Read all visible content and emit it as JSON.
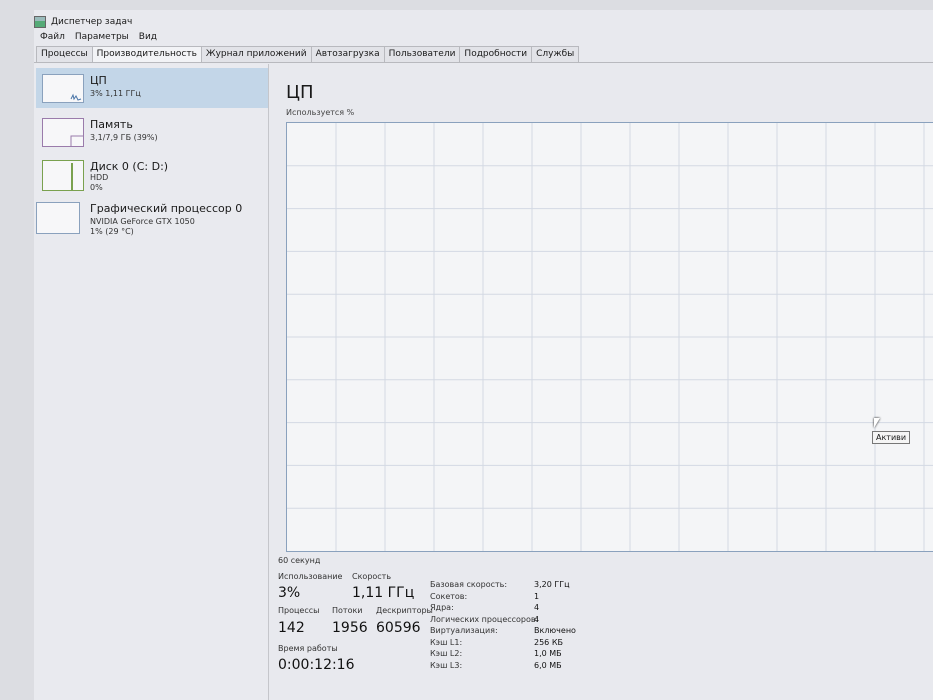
{
  "window": {
    "title": "Диспетчер задач"
  },
  "menu": [
    "Файл",
    "Параметры",
    "Вид"
  ],
  "tabs": [
    {
      "label": "Процессы",
      "active": false
    },
    {
      "label": "Производительность",
      "active": true
    },
    {
      "label": "Журнал приложений",
      "active": false
    },
    {
      "label": "Автозагрузка",
      "active": false
    },
    {
      "label": "Пользователи",
      "active": false
    },
    {
      "label": "Подробности",
      "active": false
    },
    {
      "label": "Службы",
      "active": false
    }
  ],
  "sidebar": {
    "items": [
      {
        "title": "ЦП",
        "line1": "3% 1,11 ГГц",
        "line2": ""
      },
      {
        "title": "Память",
        "line1": "3,1/7,9 ГБ (39%)",
        "line2": ""
      },
      {
        "title": "Диск 0 (C: D:)",
        "line1": "HDD",
        "line2": "0%"
      },
      {
        "title": "Графический процессор 0",
        "line1": "NVIDIA GeForce GTX 1050",
        "line2": "1% (29 °C)"
      }
    ]
  },
  "main": {
    "title": "ЦП",
    "graph_label": "Используется %",
    "time_label": "60 секунд"
  },
  "stats": {
    "usage_label": "Использование",
    "usage": "3%",
    "speed_label": "Скорость",
    "speed": "1,11 ГГц",
    "processes_label": "Процессы",
    "processes": "142",
    "threads_label": "Потоки",
    "threads": "1956",
    "handles_label": "Дескрипторы",
    "handles": "60596",
    "uptime_label": "Время работы",
    "uptime": "0:00:12:16"
  },
  "specs": [
    {
      "label": "Базовая скорость:",
      "value": "3,20 ГГц"
    },
    {
      "label": "Сокетов:",
      "value": "1"
    },
    {
      "label": "Ядра:",
      "value": "4"
    },
    {
      "label": "Логических процессоров:",
      "value": "4"
    },
    {
      "label": "Виртуализация:",
      "value": "Включено"
    },
    {
      "label": "Кэш L1:",
      "value": "256 КБ"
    },
    {
      "label": "Кэш L2:",
      "value": "1,0 МБ"
    },
    {
      "label": "Кэш L3:",
      "value": "6,0 МБ"
    }
  ],
  "tooltip": "Активи",
  "colors": {
    "cpu_accent": "#8aa1bd",
    "selected_bg": "#c3d6e8"
  }
}
